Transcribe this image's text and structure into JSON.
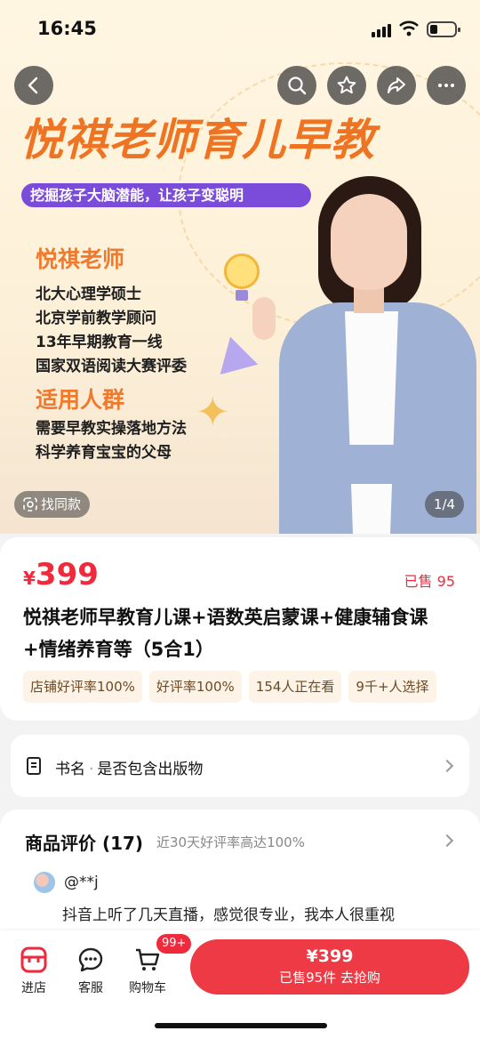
{
  "status_bar": {
    "time": "16:45"
  },
  "hero": {
    "title": "悦祺老师育儿早教",
    "ribbon": "挖掘孩子大脑潜能，让孩子变聪明",
    "teacher_heading": "悦祺老师",
    "teacher_lines": [
      "北大心理学硕士",
      "北京学前教学顾问",
      "13年早期教育一线",
      "国家双语阅读大赛评委"
    ],
    "audience_heading": "适用人群",
    "audience_lines": [
      "需要早教实操落地方法",
      "科学养育宝宝的父母"
    ],
    "find_same": "找同款",
    "pager": "1/4"
  },
  "product": {
    "currency": "¥",
    "price": "399",
    "sold": "已售 95",
    "title": "悦祺老师早教育儿课+语数英启蒙课+健康辅食课+情绪养育等（5合1）",
    "tags": [
      "店铺好评率100%",
      "好评率100%",
      "154人正在看",
      "9千+人选择"
    ]
  },
  "book_info": {
    "label": "书名",
    "value": "是否包含出版物"
  },
  "reviews": {
    "title": "商品评价 (17)",
    "subtitle": "近30天好评率高达100%",
    "first": {
      "user": "@**j",
      "text": "抖音上听了几天直播，感觉很专业，我本人很重视"
    }
  },
  "bottom_bar": {
    "shop_label": "进店",
    "service_label": "客服",
    "cart_label": "购物车",
    "cart_badge": "99+",
    "buy_price": "¥399",
    "buy_sub": "已售95件  去抢购"
  },
  "colors": {
    "accent": "#ee2a3c",
    "hero_title": "#ee7424",
    "ribbon": "#7b4cd9"
  }
}
